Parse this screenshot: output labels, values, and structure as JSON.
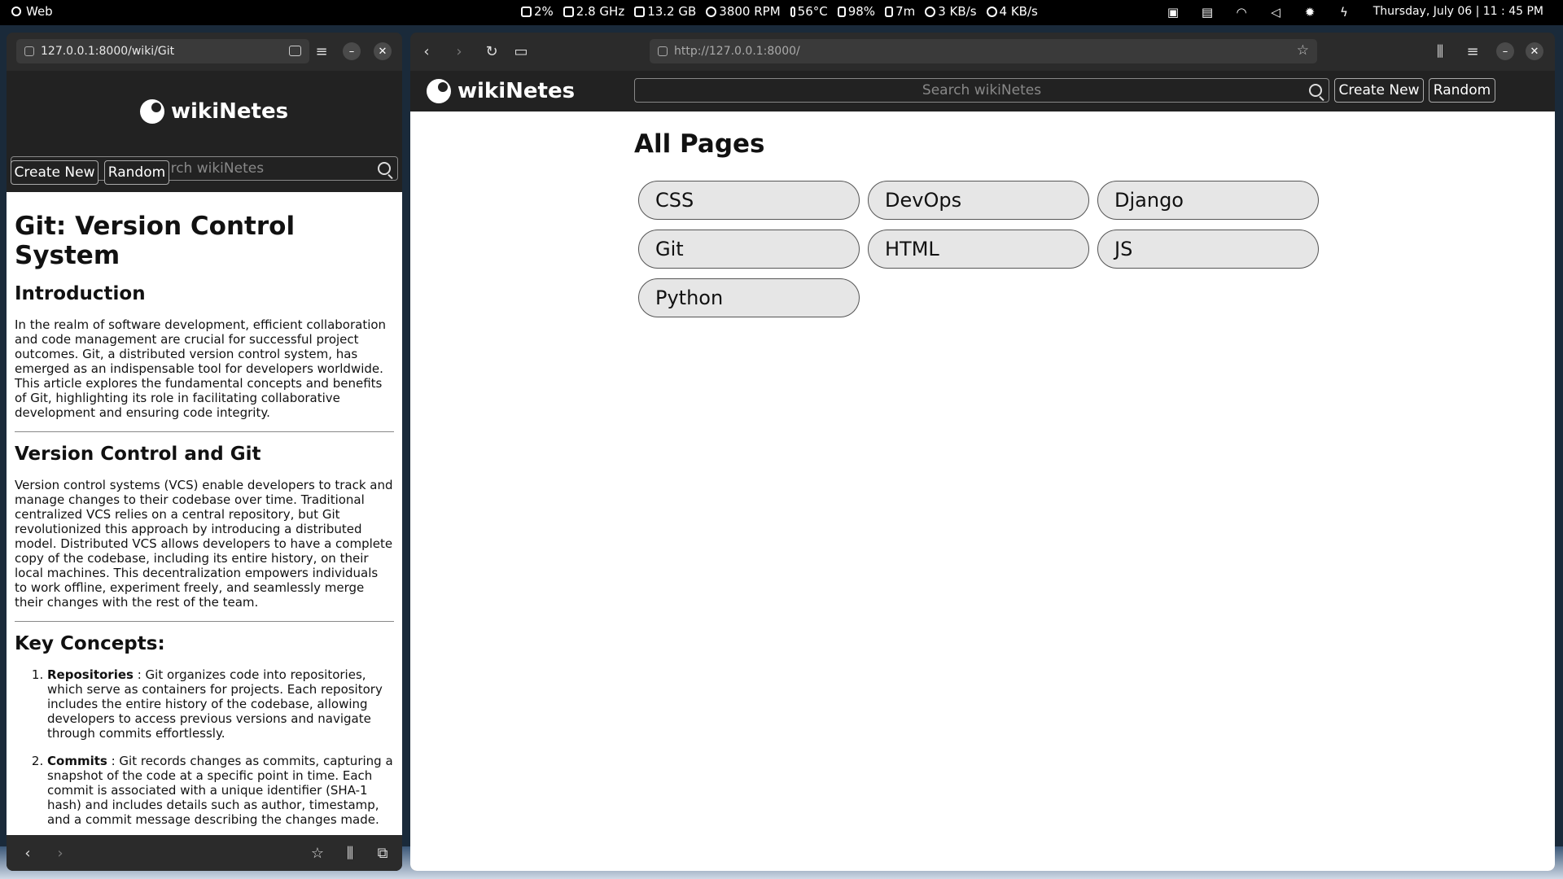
{
  "topbar": {
    "app": "Web",
    "stats": [
      "2%",
      "2.8 GHz",
      "13.2 GB",
      "3800 RPM",
      "56°C",
      "98%",
      "7m",
      "3 KB/s",
      "4 KB/s"
    ],
    "clock": "Thursday, July 06 | 11 : 45 PM"
  },
  "left_window": {
    "url": "127.0.0.1:8000/wiki/Git",
    "site_name": "wikiNetes",
    "search_placeholder": "Search wikiNetes",
    "create_label": "Create New",
    "random_label": "Random",
    "article": {
      "title": "Git: Version Control System",
      "h_intro": "Introduction",
      "p_intro": "In the realm of software development, efficient collaboration and code management are crucial for successful project outcomes. Git, a distributed version control system, has emerged as an indispensable tool for developers worldwide. This article explores the fundamental concepts and benefits of Git, highlighting its role in facilitating collaborative development and ensuring code integrity.",
      "h_vcs": "Version Control and Git",
      "p_vcs": "Version control systems (VCS) enable developers to track and manage changes to their codebase over time. Traditional centralized VCS relies on a central repository, but Git revolutionized this approach by introducing a distributed model. Distributed VCS allows developers to have a complete copy of the codebase, including its entire history, on their local machines. This decentralization empowers individuals to work offline, experiment freely, and seamlessly merge their changes with the rest of the team.",
      "h_key": "Key Concepts:",
      "items": [
        {
          "term": "Repositories",
          "text": " : Git organizes code into repositories, which serve as containers for projects. Each repository includes the entire history of the codebase, allowing developers to access previous versions and navigate through commits effortlessly."
        },
        {
          "term": "Commits",
          "text": " : Git records changes as commits, capturing a snapshot of the code at a specific point in time. Each commit is associated with a unique identifier (SHA-1 hash) and includes details such as author, timestamp, and a commit message describing the changes made."
        }
      ]
    }
  },
  "right_window": {
    "url": "http://127.0.0.1:8000/",
    "site_name": "wikiNetes",
    "search_placeholder": "Search wikiNetes",
    "create_label": "Create New",
    "random_label": "Random",
    "heading": "All Pages",
    "pages": [
      "CSS",
      "DevOps",
      "Django",
      "Git",
      "HTML",
      "JS",
      "Python"
    ]
  },
  "colors": {
    "header_bg": "#222222",
    "pill_bg": "#e6e6e6"
  }
}
